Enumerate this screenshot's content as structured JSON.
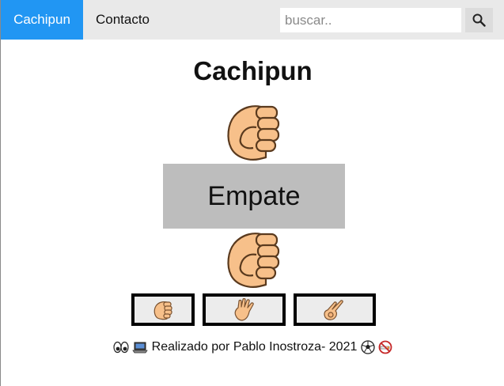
{
  "nav": {
    "brand": "Cachipun",
    "contact": "Contacto",
    "search_placeholder": "buscar..",
    "search_value": "",
    "active_color": "#2196f3",
    "bar_color": "#e9e9e9"
  },
  "game": {
    "title": "Cachipun",
    "result": "Empate",
    "top_hand": "rock-fist-icon",
    "bottom_hand": "rock-fist-icon",
    "result_bg": "#bdbdbd"
  },
  "choices": [
    {
      "name": "rock",
      "icon": "rock-hand-icon"
    },
    {
      "name": "paper",
      "icon": "paper-hand-icon"
    },
    {
      "name": "scissors",
      "icon": "scissors-hand-icon"
    }
  ],
  "footer": {
    "text": "Realizado por Pablo Inostroza- 2021",
    "icons": [
      "eyes-icon",
      "laptop-icon",
      "soccer-ball-icon",
      "no-smoking-icon"
    ]
  }
}
